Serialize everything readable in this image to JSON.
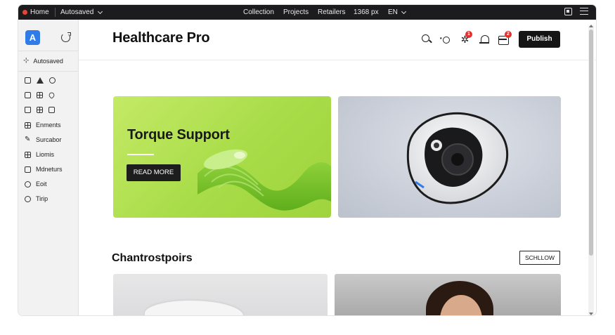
{
  "topbar": {
    "home": "Home",
    "autosaved": "Autosaved",
    "collection": "Collection",
    "projects": "Projects",
    "retailers": "Retailers",
    "width": "1368 px",
    "lang": "EN"
  },
  "sidebar": {
    "logo": "A",
    "autosaved": "Autosaved",
    "items": [
      {
        "label": "Enments",
        "icon": "grid-icon"
      },
      {
        "label": "Surcabor",
        "icon": "pen-icon"
      },
      {
        "label": "Liomis",
        "icon": "list-icon"
      },
      {
        "label": "Mdneturs",
        "icon": "folder-icon"
      },
      {
        "label": "Eoit",
        "icon": "clock-icon"
      },
      {
        "label": "Tirip",
        "icon": "search-icon"
      }
    ]
  },
  "header": {
    "title": "Healthcare Pro",
    "publish": "Publish",
    "spark_badge": "1",
    "inbox_badge": "2"
  },
  "hero": {
    "title": "Torque Support",
    "cta": "READ MORE"
  },
  "section": {
    "title": "Chantrostpoirs",
    "button": "SCHLLOW"
  },
  "colors": {
    "accent": "#2f7be8",
    "hero_green": "#b4e255",
    "dark": "#151515",
    "badge": "#e0312e"
  }
}
